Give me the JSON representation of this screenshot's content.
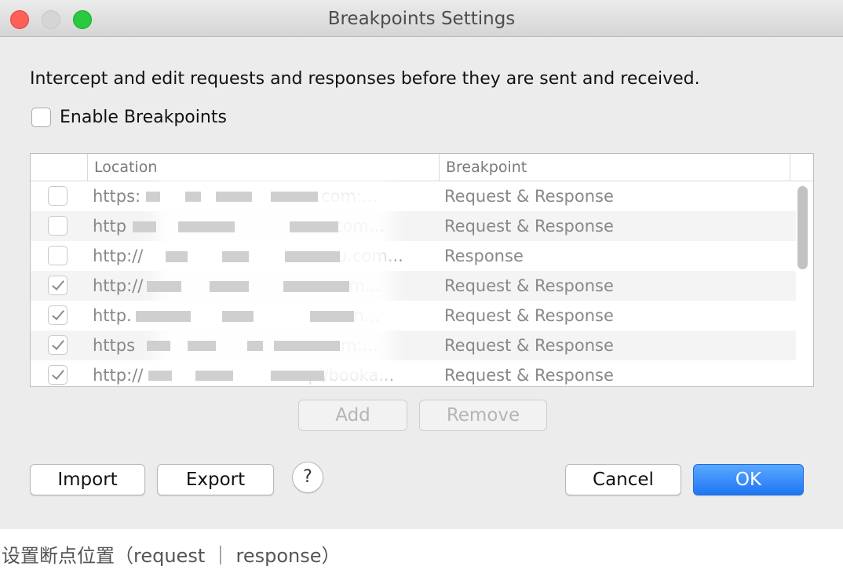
{
  "window": {
    "title": "Breakpoints Settings",
    "description": "Intercept and edit requests and responses before they are sent and received.",
    "enable_label": "Enable Breakpoints",
    "enable_checked": false
  },
  "table": {
    "headers": {
      "location": "Location",
      "breakpoint": "Breakpoint"
    },
    "rows": [
      {
        "checked": false,
        "location": "https:          u.com:...",
        "breakpoint": "Request & Response"
      },
      {
        "checked": false,
        "location": "http           ou.com...",
        "breakpoint": "Request & Response"
      },
      {
        "checked": false,
        "location": "http://          asou.com...",
        "breakpoint": "Response"
      },
      {
        "checked": true,
        "location": "http://           .com...",
        "breakpoint": "Request & Response"
      },
      {
        "checked": true,
        "location": "http.           u.com...",
        "breakpoint": "Request & Response"
      },
      {
        "checked": true,
        "location": "https           .com:...",
        "breakpoint": "Request & Response"
      },
      {
        "checked": true,
        "location": "http://          pi/booka...",
        "breakpoint": "Request & Response"
      }
    ]
  },
  "buttons": {
    "add": "Add",
    "remove": "Remove",
    "import": "Import",
    "export": "Export",
    "help": "?",
    "cancel": "Cancel",
    "ok": "OK"
  },
  "caption": "设置断点位置（request ｜ response）"
}
